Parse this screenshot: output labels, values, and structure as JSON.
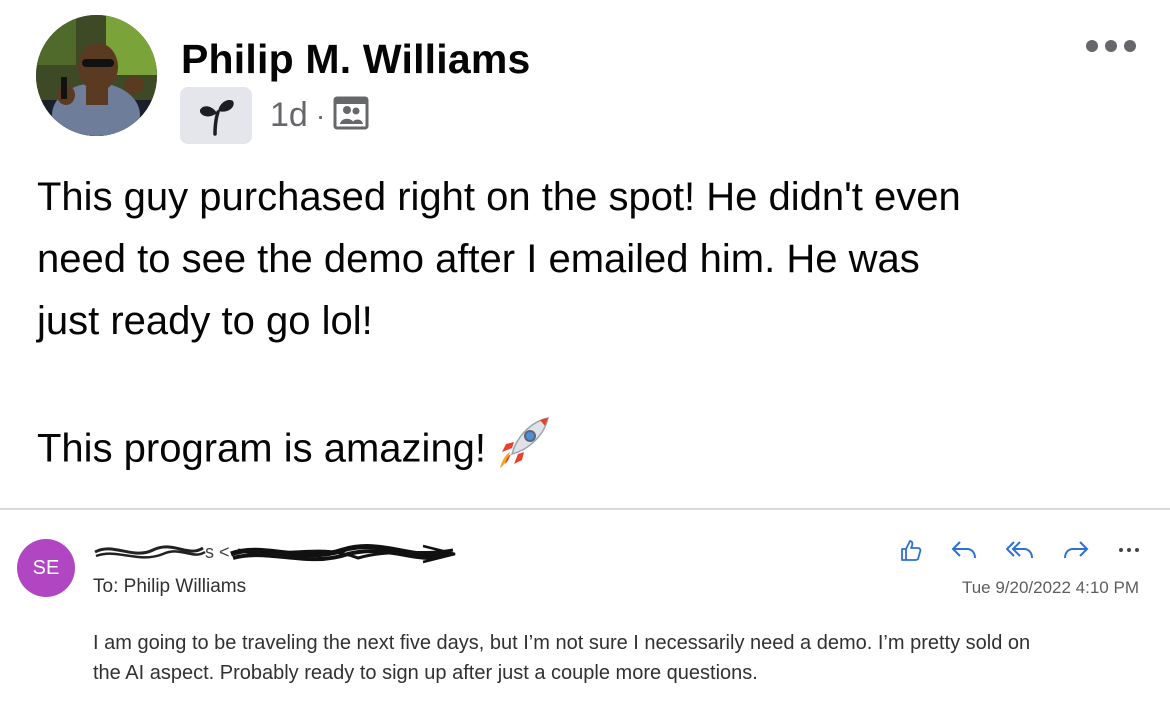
{
  "post": {
    "author_name": "Philip M. Williams",
    "time": "1d",
    "separator": "·",
    "audience_icon": "group-icon",
    "badge_icon": "sprout-icon",
    "more_icon": "more-icon",
    "text_lines": [
      "This guy purchased right on the spot!  He didn't even",
      "need to see the demo after I emailed him. He was",
      "just ready to go lol!"
    ],
    "text_closing": "This program is amazing!",
    "emoji": "rocket-icon"
  },
  "email": {
    "sender_initials": "SE",
    "sender_display": "redacted (scribbled out)",
    "to_label": "To:",
    "to_name": "Philip Williams",
    "date": "Tue 9/20/2022 4:10 PM",
    "body_lines": [
      "I am going to be traveling the next five days, but I’m not sure I necessarily need a demo. I’m pretty sold on",
      "the AI aspect. Probably ready to sign up after just a couple more questions."
    ],
    "actions": [
      "like-icon",
      "reply-icon",
      "reply-all-icon",
      "forward-icon",
      "more-icon"
    ],
    "avatar_color": "#b146c2"
  }
}
